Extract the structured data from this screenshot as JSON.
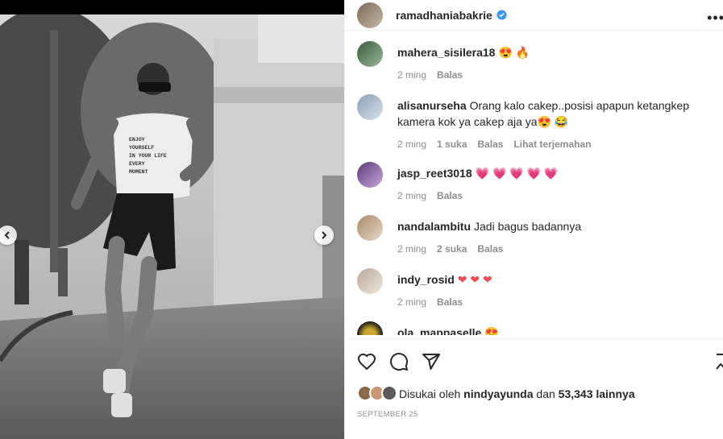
{
  "post": {
    "username": "ramadhaniabakrie",
    "photo_shirt_text": [
      "ENJOY",
      "YOURSELF",
      "IN YOUR LIFE",
      "EVERY",
      "MOMENT"
    ]
  },
  "comments": [
    {
      "username": "mahera_sisilera18",
      "text": "😍 🔥",
      "time": "2 ming",
      "likes": "",
      "reply": "Balas",
      "translate": ""
    },
    {
      "username": "alisanurseha",
      "text": "Orang kalo cakep..posisi apapun ketangkep kamera kok ya cakep aja ya😍 😂",
      "time": "2 ming",
      "likes": "1 suka",
      "reply": "Balas",
      "translate": "Lihat terjemahan"
    },
    {
      "username": "jasp_reet3018",
      "text": "💗 💗 💗 💗 💗",
      "time": "2 ming",
      "likes": "",
      "reply": "Balas",
      "translate": ""
    },
    {
      "username": "nandalambitu",
      "text": "Jadi bagus badannya",
      "time": "2 ming",
      "likes": "2 suka",
      "reply": "Balas",
      "translate": ""
    },
    {
      "username": "indy_rosid",
      "text": "❤ ❤ ❤",
      "time": "2 ming",
      "likes": "",
      "reply": "Balas",
      "translate": ""
    },
    {
      "username": "ola_mappaselle",
      "text": "😍",
      "time": "",
      "likes": "",
      "reply": "",
      "translate": ""
    }
  ],
  "likes": {
    "prefix": "Disukai oleh",
    "user": "nindyayunda",
    "middle": "dan",
    "count": "53,343 lainnya"
  },
  "date": "SEPTEMBER 25",
  "icons": {
    "verified": "verified-badge-icon",
    "more": "more-options-icon",
    "like": "heart-outline-icon",
    "comment": "comment-bubble-icon",
    "share": "paper-plane-icon",
    "save": "bookmark-icon",
    "prev": "chevron-left-icon",
    "next": "chevron-right-icon"
  },
  "colors": {
    "verified": "#3897f0",
    "text": "#262626",
    "muted": "#8e8e8e",
    "heart": "#ed4956"
  }
}
